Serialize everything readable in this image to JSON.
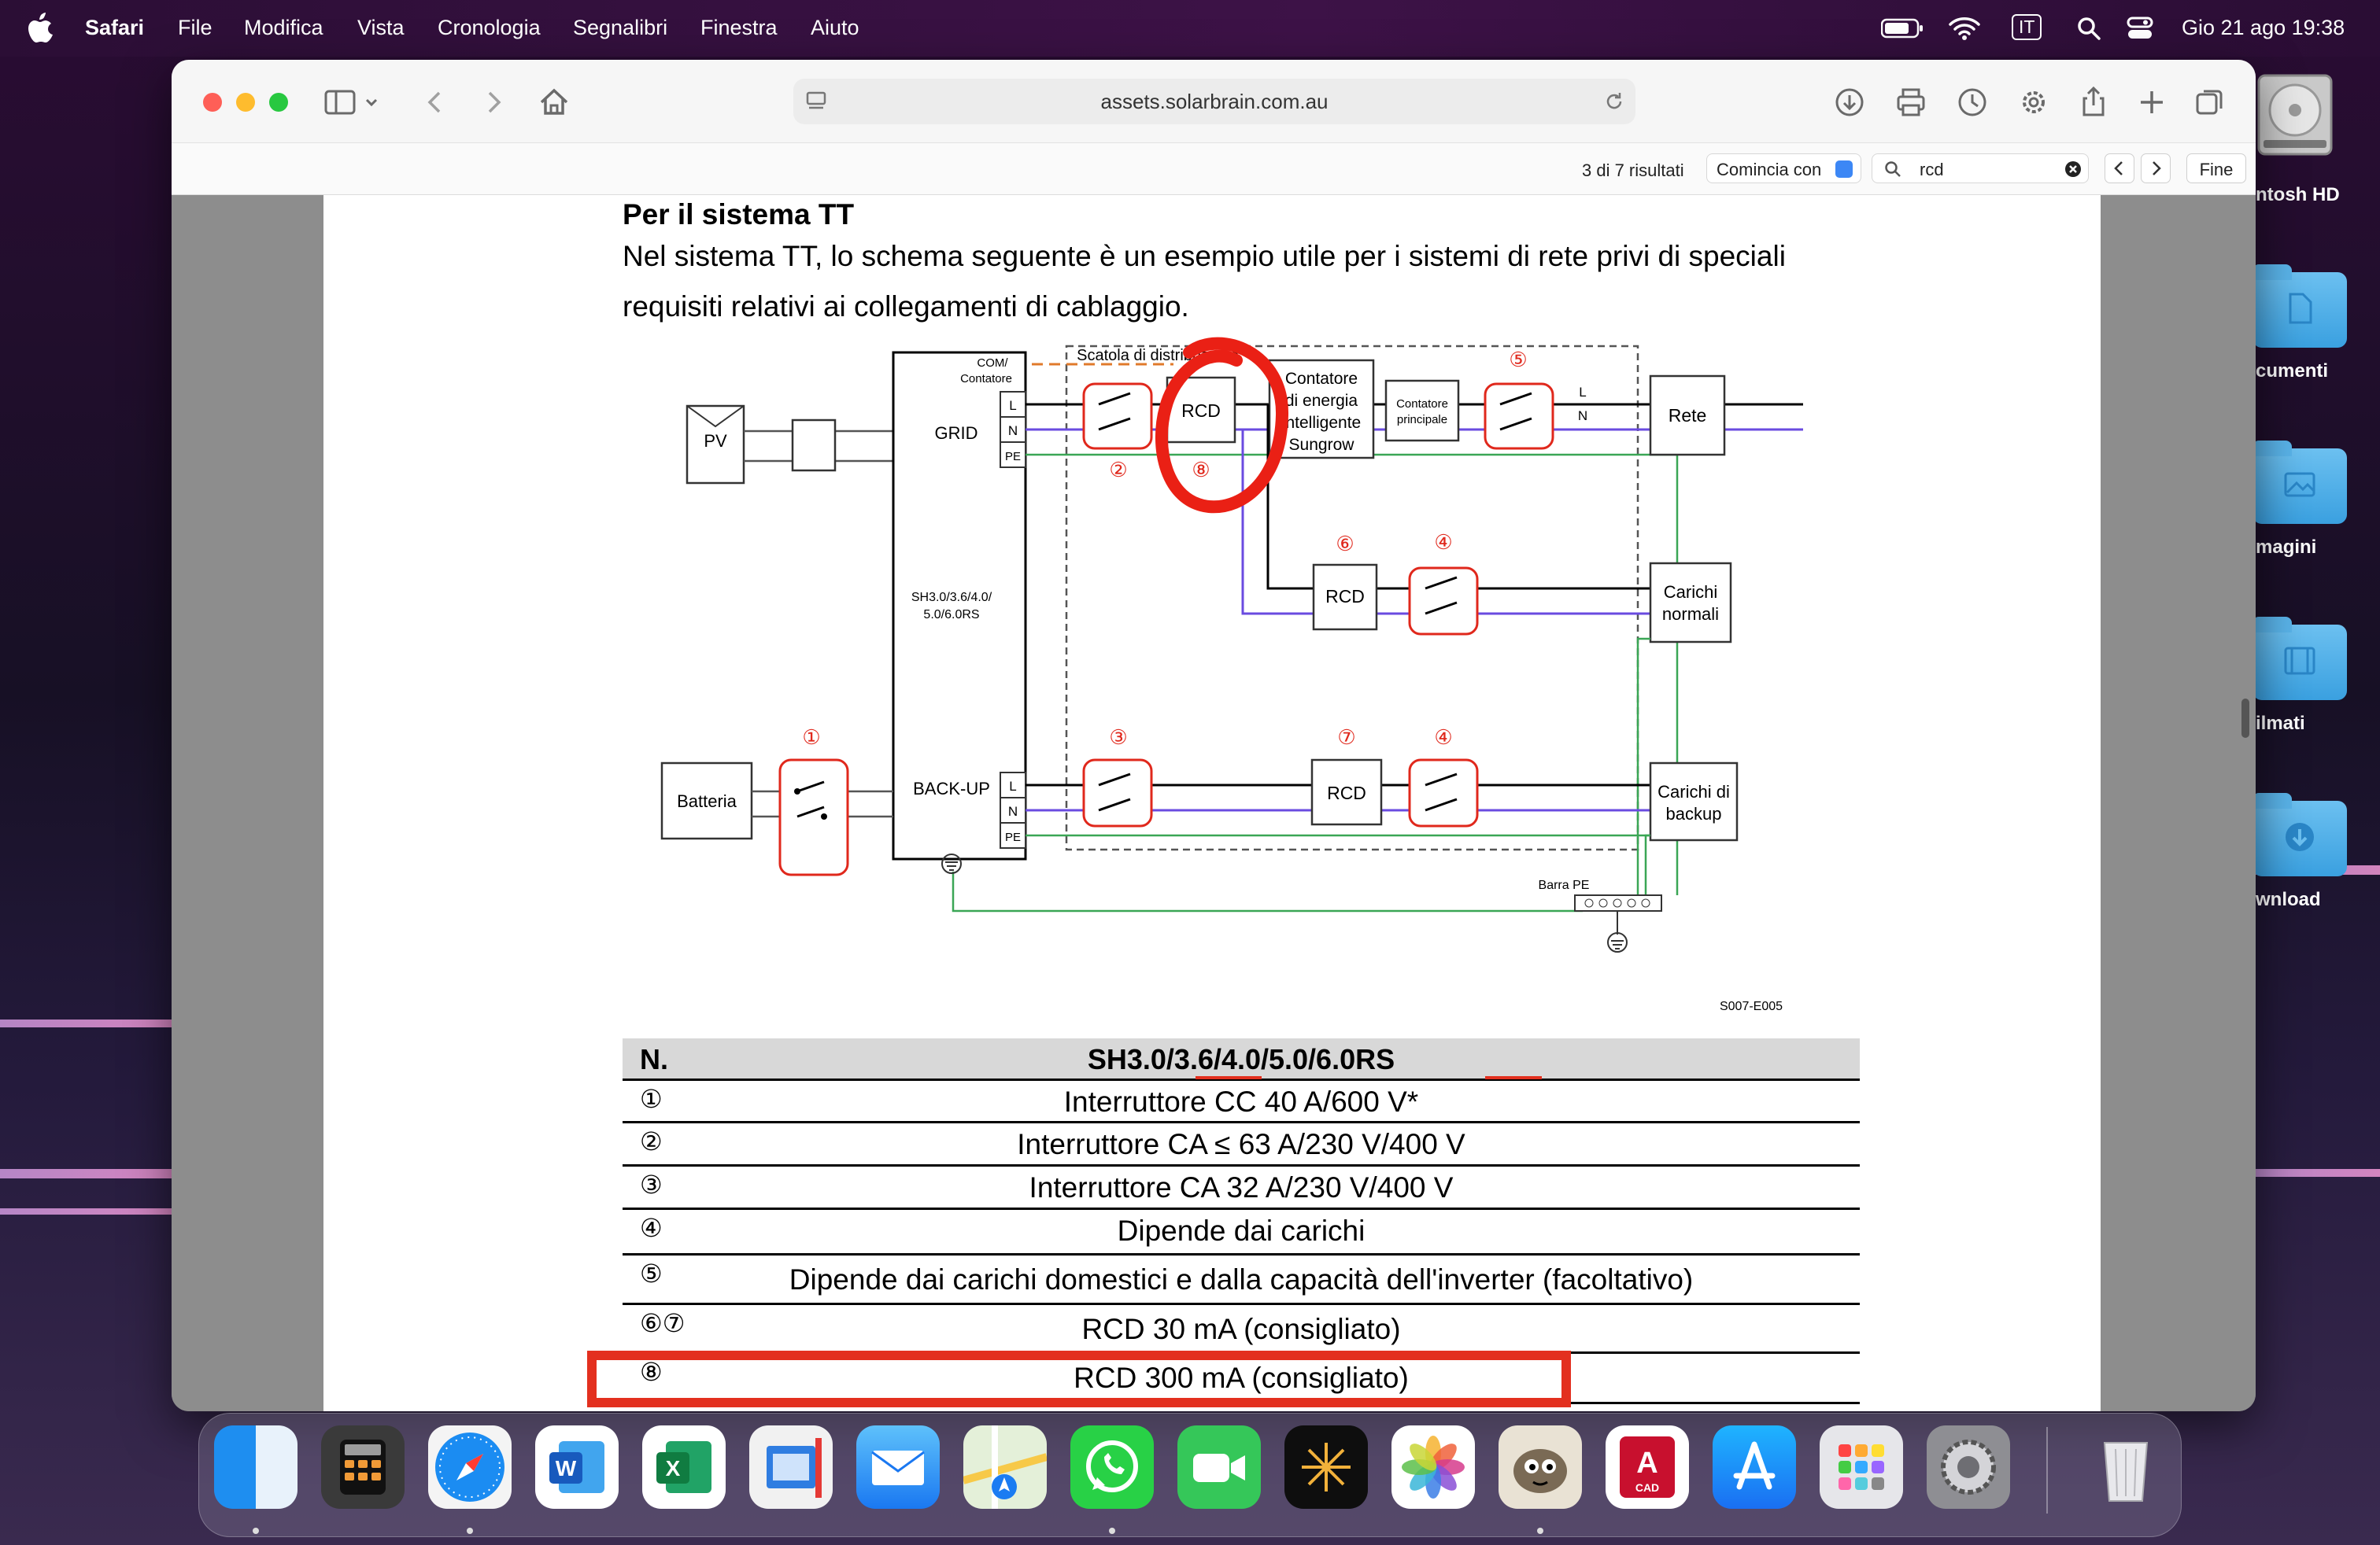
{
  "menubar": {
    "app": "Safari",
    "items": [
      "File",
      "Modifica",
      "Vista",
      "Cronologia",
      "Segnalibri",
      "Finestra",
      "Aiuto"
    ],
    "input_source": "IT",
    "datetime": "Gio 21 ago  19:38"
  },
  "desktop": {
    "disk_label": "ntosh HD",
    "folders": [
      "cumenti",
      "magini",
      "ilmati",
      "wnload"
    ]
  },
  "browser": {
    "url": "assets.solarbrain.com.au",
    "find": {
      "results": "3 di 7 risultati",
      "mode": "Comincia con",
      "query": "rcd",
      "done": "Fine"
    }
  },
  "document": {
    "heading": "Per il sistema TT",
    "paragraph": "Nel sistema TT, lo schema seguente è un esempio utile per i sistemi di rete privi di speciali requisiti relativi ai collegamenti di cablaggio.",
    "diagram": {
      "pv": "PV",
      "battery": "Batteria",
      "com": "COM/\nContatore",
      "grid": "GRID",
      "backup": "BACK-UP",
      "inverter": "SH3.0/3.6/4.0/\n5.0/6.0RS",
      "distribution_box": "Scatola di distribuzione",
      "energy_meter": "Contatore di energia intelligente Sungrow",
      "main_meter": "Contatore principale",
      "grid_out": "Rete",
      "normal_loads": "Carichi normali",
      "backup_loads": "Carichi di backup",
      "rcd": "RCD",
      "pe_bar": "Barra PE",
      "terminals": [
        "L",
        "N",
        "PE"
      ],
      "ln": [
        "L",
        "N"
      ],
      "code": "S007-E005",
      "markers": [
        "①",
        "②",
        "③",
        "④",
        "⑤",
        "⑥",
        "⑦",
        "⑧"
      ]
    },
    "table": {
      "header_n": "N.",
      "header_title": "SH3.0/3.6/4.0/5.0/6.0RS",
      "rows": [
        {
          "n": "①",
          "text": "Interruttore CC 40 A/600 V*"
        },
        {
          "n": "②",
          "text": "Interruttore CA ≤ 63 A/230 V/400 V"
        },
        {
          "n": "③",
          "text": "Interruttore CA 32 A/230 V/400 V"
        },
        {
          "n": "④",
          "text": "Dipende dai carichi"
        },
        {
          "n": "⑤",
          "text": "Dipende dai carichi domestici e dalla capacità dell'inverter (facoltativo)"
        },
        {
          "n": "⑥⑦",
          "text": "RCD 30 mA (consigliato)"
        },
        {
          "n": "⑧",
          "text": "RCD 300 mA (consigliato)"
        }
      ]
    }
  },
  "dock": {
    "apps": [
      "Finder",
      "Calcolatrice",
      "Safari",
      "Word",
      "Excel",
      "Migration",
      "Mail",
      "Mappe",
      "WhatsApp",
      "FaceTime",
      "Perplexity",
      "Foto",
      "GIMP",
      "AutoCAD",
      "App Store",
      "Launchpad",
      "Impostazioni di Sistema",
      "Cestino"
    ]
  }
}
